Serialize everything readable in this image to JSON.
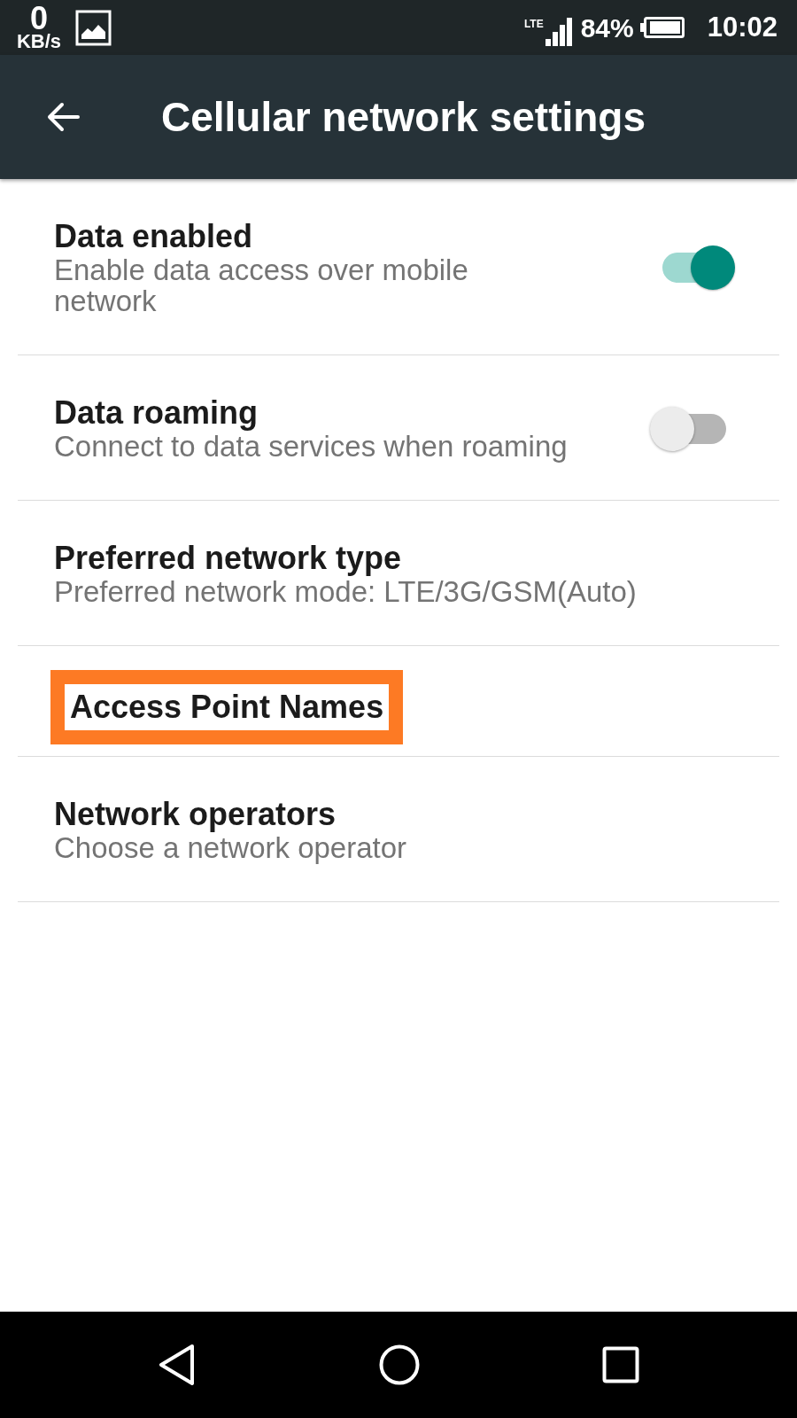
{
  "status_bar": {
    "speed_value": "0",
    "speed_unit": "KB/s",
    "network_type": "LTE",
    "battery_percent": "84%",
    "time": "10:02"
  },
  "toolbar": {
    "title": "Cellular network settings"
  },
  "settings": [
    {
      "kind": "toggle",
      "title": "Data enabled",
      "summary": "Enable data access over mobile network",
      "on": true,
      "highlighted": false
    },
    {
      "kind": "toggle",
      "title": "Data roaming",
      "summary": "Connect to data services when roaming",
      "on": false,
      "highlighted": false
    },
    {
      "kind": "plain",
      "title": "Preferred network type",
      "summary": "Preferred network mode: LTE/3G/GSM(Auto)",
      "highlighted": false
    },
    {
      "kind": "plain",
      "title": "Access Point Names",
      "highlighted": true
    },
    {
      "kind": "plain",
      "title": "Network operators",
      "summary": "Choose a network operator",
      "highlighted": false
    }
  ]
}
